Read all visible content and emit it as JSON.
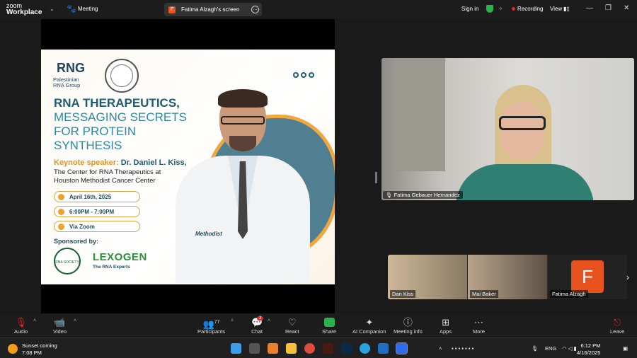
{
  "app": {
    "logo_line1": "zoom",
    "logo_line2": "Workplace",
    "meeting_label": "Meeting"
  },
  "screen_pill": {
    "avatar_letter": "F",
    "label": "Fatima Alzagh's screen"
  },
  "topright": {
    "signin": "Sign in",
    "recording": "Recording",
    "view": "View"
  },
  "slide": {
    "logo_text": "RNG",
    "logo_sub1": "Palestinian",
    "logo_sub2": "RNA Group",
    "title_line1": "RNA THERAPEUTICS,",
    "title_line2": "MESSAGING SECRETS",
    "title_line3": "FOR PROTEIN",
    "title_line4": "SYNTHESIS",
    "keynote_label": "Keynote speaker:",
    "keynote_name": "Dr. Daniel L. Kiss,",
    "affiliation_line1": "The Center for RNA Therapeutics at",
    "affiliation_line2": "Houston Methodist Cancer Center",
    "date": "April 16th, 2025",
    "time": "6:00PM - 7:00PM",
    "venue": "Via Zoom",
    "sponsored": "Sponsored by:",
    "sponsor1": "RNA SOCIETY",
    "sponsor2": "LEXOGEN",
    "sponsor2_tag": "The RNA Experts",
    "coat_text": "Methodist"
  },
  "speaker": {
    "name": "Fatima Gebauer Hernandez"
  },
  "thumbnails": [
    {
      "name": "Dan Kiss"
    },
    {
      "name": "Mai Baker"
    },
    {
      "name": "Fatima Alzagh",
      "avatar_letter": "F"
    }
  ],
  "toolbar": {
    "audio": "Audio",
    "video": "Video",
    "participants": "Participants",
    "participants_count": "77",
    "chat": "Chat",
    "chat_badge": "3",
    "react": "React",
    "share": "Share",
    "ai": "AI Companion",
    "meeting_info": "Meeting info",
    "apps": "Apps",
    "more": "More",
    "leave": "Leave"
  },
  "taskbar": {
    "weather_line1": "Sunset coming",
    "weather_line2": "7:08 PM",
    "lang": "ENG",
    "time": "6:12 PM",
    "date": "4/16/2025"
  },
  "colors": {
    "accent": "#2bb24c",
    "brand_orange": "#e8521f",
    "slide_teal": "#1f5b72",
    "slide_orange": "#e39520"
  }
}
